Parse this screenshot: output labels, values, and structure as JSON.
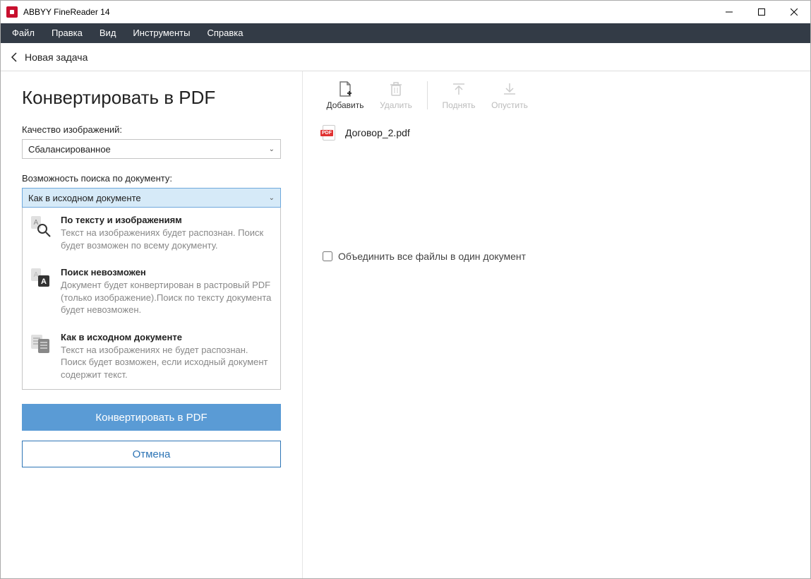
{
  "window": {
    "title": "ABBYY FineReader 14"
  },
  "menubar": {
    "items": [
      "Файл",
      "Правка",
      "Вид",
      "Инструменты",
      "Справка"
    ]
  },
  "navbar": {
    "back_label": "Новая задача"
  },
  "left": {
    "title": "Конвертировать в PDF",
    "quality_label": "Качество изображений:",
    "quality_value": "Сбалансированное",
    "search_label": "Возможность поиска по документу:",
    "search_value": "Как в исходном документе",
    "dropdown": [
      {
        "title": "По тексту и изображениям",
        "desc": "Текст на изображениях будет распознан. Поиск будет возможен по всему документу."
      },
      {
        "title": "Поиск невозможен",
        "desc": "Документ будет конвертирован в растровый PDF (только изображение).Поиск по тексту документа будет невозможен."
      },
      {
        "title": "Как в исходном документе",
        "desc": "Текст на изображениях не будет распознан. Поиск будет возможен, если исходный документ содержит текст."
      }
    ],
    "primary": "Конвертировать в PDF",
    "secondary": "Отмена"
  },
  "toolbar": {
    "add": "Добавить",
    "delete": "Удалить",
    "up": "Поднять",
    "down": "Опустить"
  },
  "files": [
    {
      "name": "Договор_2.pdf"
    }
  ],
  "combine": {
    "label": "Объединить все файлы в один документ",
    "checked": false
  }
}
